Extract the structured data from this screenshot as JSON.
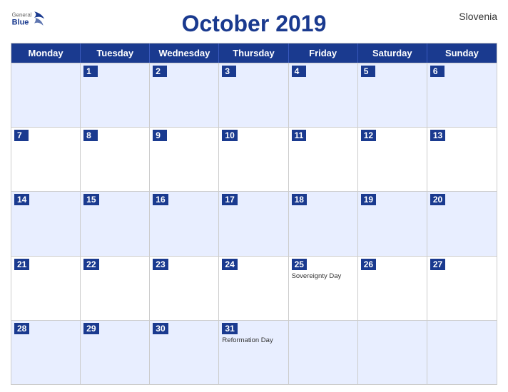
{
  "header": {
    "logo": {
      "general": "General",
      "blue": "Blue"
    },
    "title": "October 2019",
    "country": "Slovenia"
  },
  "dayHeaders": [
    "Monday",
    "Tuesday",
    "Wednesday",
    "Thursday",
    "Friday",
    "Saturday",
    "Sunday"
  ],
  "weeks": [
    [
      {
        "num": "",
        "empty": true
      },
      {
        "num": "1"
      },
      {
        "num": "2"
      },
      {
        "num": "3"
      },
      {
        "num": "4"
      },
      {
        "num": "5"
      },
      {
        "num": "6"
      }
    ],
    [
      {
        "num": "7"
      },
      {
        "num": "8"
      },
      {
        "num": "9"
      },
      {
        "num": "10"
      },
      {
        "num": "11"
      },
      {
        "num": "12"
      },
      {
        "num": "13"
      }
    ],
    [
      {
        "num": "14"
      },
      {
        "num": "15"
      },
      {
        "num": "16"
      },
      {
        "num": "17"
      },
      {
        "num": "18"
      },
      {
        "num": "19"
      },
      {
        "num": "20"
      }
    ],
    [
      {
        "num": "21"
      },
      {
        "num": "22"
      },
      {
        "num": "23"
      },
      {
        "num": "24"
      },
      {
        "num": "25",
        "event": "Sovereignty Day"
      },
      {
        "num": "26"
      },
      {
        "num": "27"
      }
    ],
    [
      {
        "num": "28"
      },
      {
        "num": "29"
      },
      {
        "num": "30"
      },
      {
        "num": "31",
        "event": "Reformation Day"
      },
      {
        "num": ""
      },
      {
        "num": ""
      },
      {
        "num": ""
      }
    ]
  ],
  "colors": {
    "header_bg": "#1a3a8f",
    "odd_row": "#e8eeff",
    "even_row": "#ffffff",
    "border": "#aabbdd"
  }
}
